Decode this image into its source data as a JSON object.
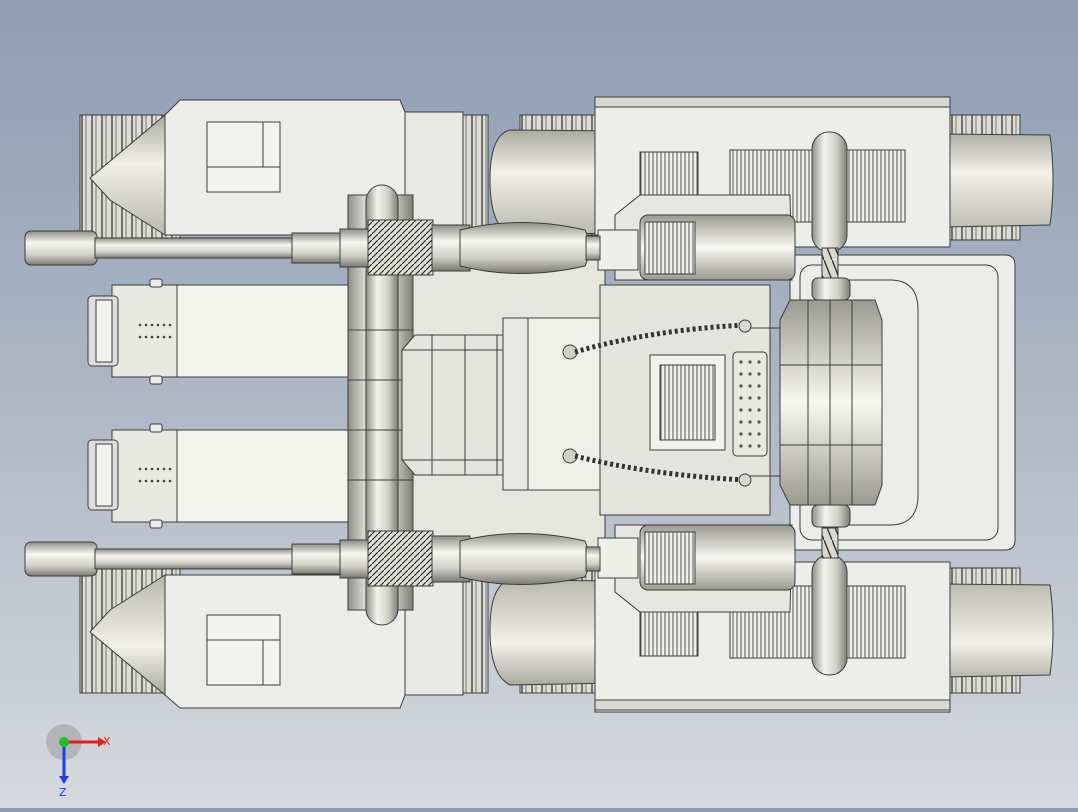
{
  "viewport": {
    "background_top": "#8d9db4",
    "background_bottom": "#d6d9de",
    "model_fill": "#ececec",
    "model_fill_light": "#f6f6f2",
    "model_edge": "#3c3c3c",
    "shadow": "#a9a9a0"
  },
  "triad": {
    "x_label": "X",
    "z_label": "Z",
    "x_color": "#e0201e",
    "y_color": "#1fbf1f",
    "z_color": "#2040e0"
  }
}
